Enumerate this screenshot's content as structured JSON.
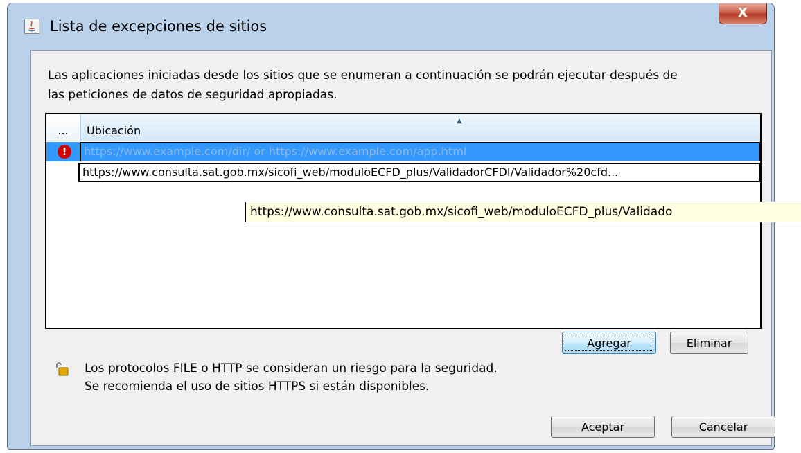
{
  "window": {
    "title": "Lista de excepciones de sitios",
    "close_label": "X"
  },
  "description": {
    "line1": "Las aplicaciones iniciadas desde los sitios que se enumeran a continuación se podrán ejecutar después de",
    "line2": "las peticiones de datos de seguridad apropiadas."
  },
  "table": {
    "columns": [
      "...",
      "Ubicación"
    ],
    "rows": [
      {
        "icon": "error-icon",
        "url": "https://www.example.com/dir/ or https://www.example.com/app.html",
        "placeholder": true
      },
      {
        "icon": "",
        "url": "https://www.consulta.sat.gob.mx/sicofi_web/moduloECFD_plus/ValidadorCFDI/Validador%20cfd..."
      }
    ],
    "tooltip": "https://www.consulta.sat.gob.mx/sicofi_web/moduloECFD_plus/Validado"
  },
  "buttons": {
    "add": "Agregar",
    "remove": "Eliminar",
    "ok": "Aceptar",
    "cancel": "Cancelar"
  },
  "warning": {
    "icon": "unlocked-padlock-icon",
    "line1": "Los protocolos FILE o HTTP se consideran un riesgo para la seguridad.",
    "line2": "Se recomienda el uso de sitios HTTPS si están disponibles."
  },
  "colors": {
    "selection": "#3399ff",
    "error": "#d40000",
    "tooltip_bg": "#ffffe1"
  }
}
